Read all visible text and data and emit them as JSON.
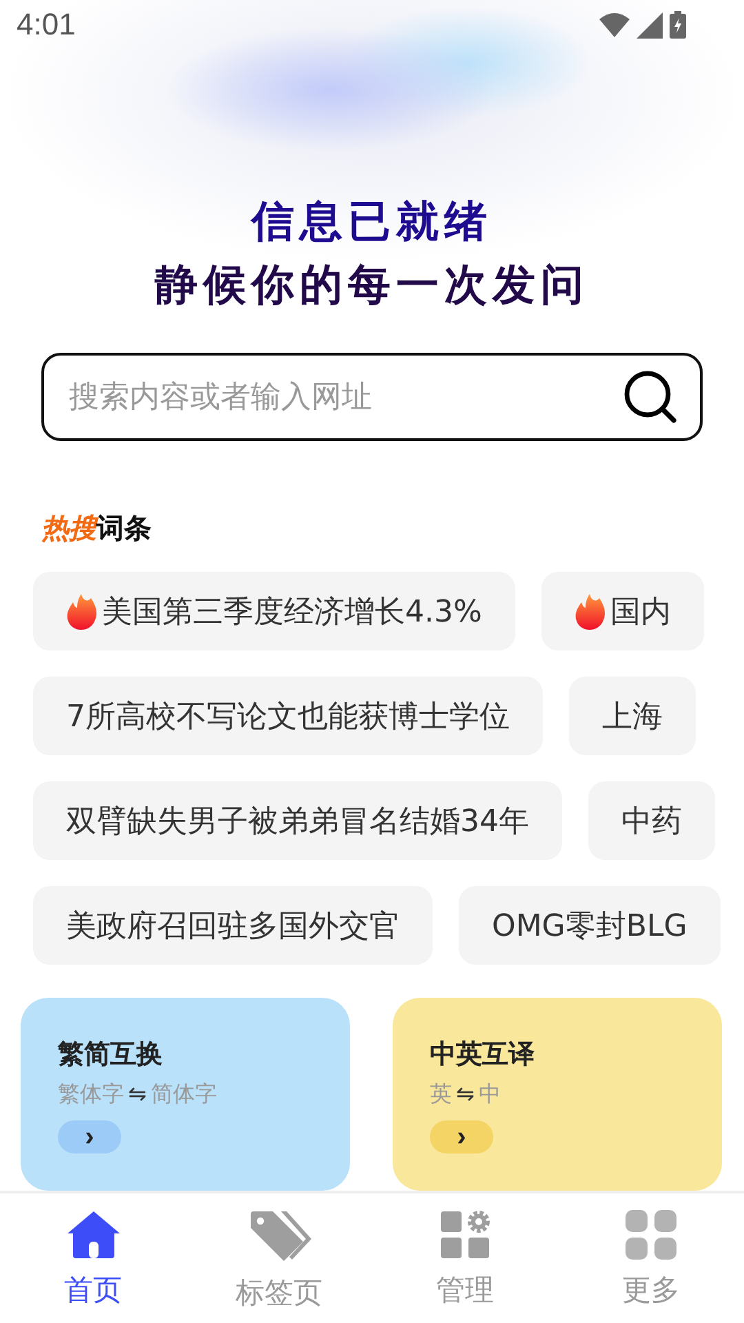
{
  "status_bar": {
    "time": "4:01"
  },
  "headline": [
    "信息已就绪",
    "静候你的每一次发问"
  ],
  "search": {
    "placeholder": "搜索内容或者输入网址"
  },
  "hot_section": {
    "badge": "热搜",
    "title": "词条"
  },
  "hot_rows": [
    [
      {
        "text": "美国第三季度经济增长4.3%",
        "hot": true
      },
      {
        "text": "国内",
        "hot": true
      }
    ],
    [
      {
        "text": "7所高校不写论文也能获博士学位",
        "hot": false
      },
      {
        "text": "上海",
        "hot": false
      }
    ],
    [
      {
        "text": "双臂缺失男子被弟弟冒名结婚34年",
        "hot": false
      },
      {
        "text": "中药",
        "hot": false
      }
    ],
    [
      {
        "text": "美政府召回驻多国外交官",
        "hot": false
      },
      {
        "text": "OMG零封BLG",
        "hot": false
      }
    ]
  ],
  "tools": [
    {
      "title": "繁简互换",
      "from": "繁体字",
      "arrow": "⇋",
      "to": "简体字",
      "color": "#b9e1fa"
    },
    {
      "title": "中英互译",
      "from": "英",
      "arrow": "⇋",
      "to": "中",
      "color": "#f9e79b"
    }
  ],
  "tool_button": "›",
  "nav": [
    {
      "label": "首页",
      "kind": "home",
      "selected": true
    },
    {
      "label": "标签页",
      "kind": "tags",
      "selected": false
    },
    {
      "label": "管理",
      "kind": "manage",
      "selected": false
    },
    {
      "label": "更多",
      "kind": "more",
      "selected": false
    }
  ]
}
